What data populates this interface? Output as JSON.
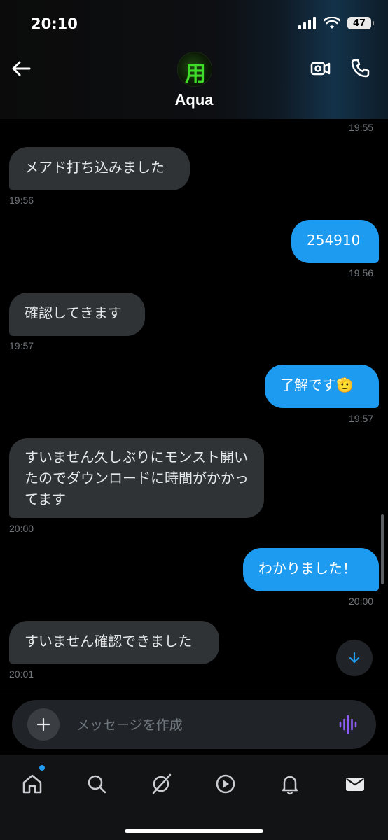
{
  "status_bar": {
    "time": "20:10",
    "battery": "47"
  },
  "header": {
    "contact_name": "Aqua",
    "avatar_text": "用"
  },
  "messages": [
    {
      "text": "",
      "time": "19:55"
    },
    {
      "text": "メアド打ち込みました",
      "time": "19:56"
    },
    {
      "text": "254910",
      "time": "19:56"
    },
    {
      "text": "確認してきます",
      "time": "19:57"
    },
    {
      "text": "了解です🫡",
      "time": "19:57"
    },
    {
      "text": "すいません久しぶりにモンスト開いたのでダウンロードに時間がかかってます",
      "time": "20:00"
    },
    {
      "text": "わかりました！",
      "time": "20:00"
    },
    {
      "text": "すいません確認できました",
      "time": "20:01"
    }
  ],
  "composer": {
    "placeholder": "メッセージを作成"
  },
  "colors": {
    "accent": "#1d9bf0",
    "incoming_bubble": "#2f3336",
    "voice_icon": "#8b5cf6"
  },
  "nav": [
    "home-icon",
    "search-icon",
    "grok-icon",
    "play-icon",
    "bell-icon",
    "mail-icon"
  ]
}
